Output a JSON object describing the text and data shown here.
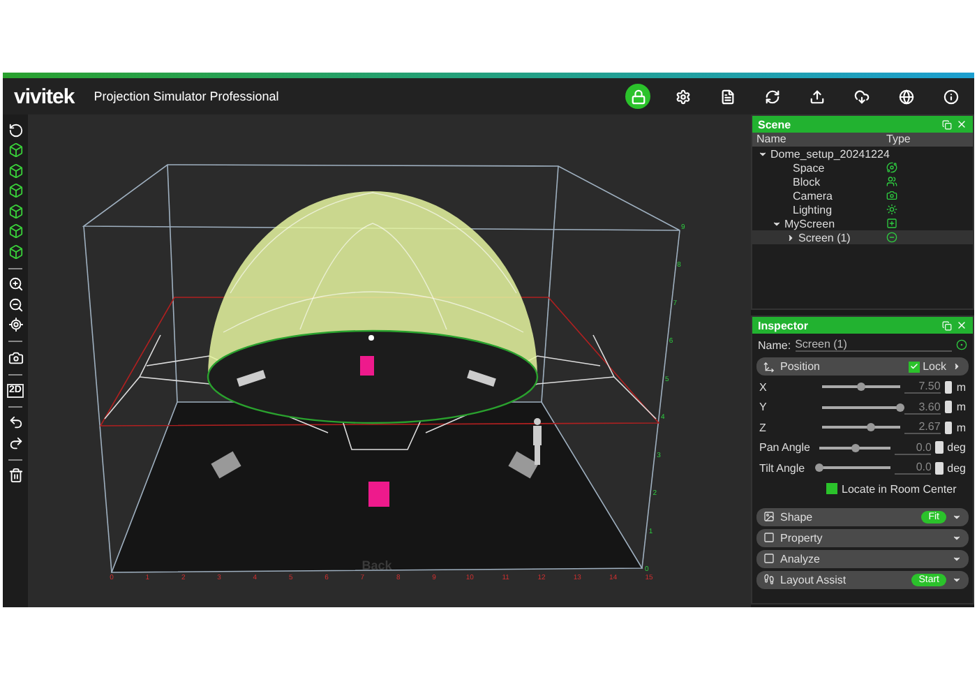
{
  "app": {
    "logo": "vivitek",
    "title": "Projection Simulator Professional"
  },
  "toolbar": [
    {
      "kind": "lock",
      "on": true
    },
    {
      "kind": "settings",
      "on": false
    },
    {
      "kind": "file",
      "on": false
    },
    {
      "kind": "refresh",
      "on": false
    },
    {
      "kind": "upload",
      "on": false
    },
    {
      "kind": "download",
      "on": false
    },
    {
      "kind": "globe",
      "on": false
    },
    {
      "kind": "info",
      "on": false
    }
  ],
  "left_tools": [
    {
      "kind": "rotate"
    },
    {
      "kind": "cube"
    },
    {
      "kind": "cube"
    },
    {
      "kind": "cube"
    },
    {
      "kind": "cube"
    },
    {
      "kind": "cube"
    },
    {
      "kind": "cube"
    },
    {
      "kind": "separator"
    },
    {
      "kind": "zoom_in"
    },
    {
      "kind": "zoom_out"
    },
    {
      "kind": "locate"
    },
    {
      "kind": "separator"
    },
    {
      "kind": "camera"
    },
    {
      "kind": "separator"
    },
    {
      "kind": "text",
      "label": "2D"
    },
    {
      "kind": "separator"
    },
    {
      "kind": "undo"
    },
    {
      "kind": "redo"
    },
    {
      "kind": "separator"
    },
    {
      "kind": "trash"
    }
  ],
  "viewport": {
    "floor_label": "Back",
    "x_ticks": [
      "0",
      "1",
      "2",
      "3",
      "4",
      "5",
      "6",
      "7",
      "8",
      "9",
      "10",
      "11",
      "12",
      "13",
      "14",
      "15"
    ],
    "z_ticks": [
      "0",
      "1",
      "2",
      "3",
      "4",
      "5",
      "6",
      "7",
      "8",
      "9"
    ]
  },
  "scene": {
    "title": "Scene",
    "columns": [
      "Name",
      "Type"
    ],
    "tree": [
      {
        "name": "Dome_setup_20241224",
        "expanded": true,
        "selected": false,
        "children": [
          {
            "name": "Space",
            "kind": "space",
            "selected": false
          },
          {
            "name": "Block",
            "kind": "block",
            "selected": false
          },
          {
            "name": "Camera",
            "kind": "camera",
            "selected": false
          },
          {
            "name": "Lighting",
            "kind": "lighting",
            "selected": false
          },
          {
            "name": "MyScreen",
            "kind": "group",
            "expanded": true,
            "selected": false,
            "children": [
              {
                "name": "Screen (1)",
                "kind": "screen",
                "expanded": false,
                "selected": true
              }
            ]
          }
        ]
      }
    ]
  },
  "inspector": {
    "title": "Inspector",
    "name_label": "Name:",
    "name_value": "Screen (1)",
    "position": {
      "title": "Position",
      "lock_label": "Lock",
      "lock_checked": true
    },
    "fields": [
      {
        "label": "X",
        "level": 0.5,
        "value": "7.50",
        "unit": "m"
      },
      {
        "label": "Y",
        "level": 1.0,
        "value": "3.60",
        "unit": "m"
      },
      {
        "label": "Z",
        "level": 0.62,
        "value": "2.67",
        "unit": "m"
      },
      {
        "label": "Pan Angle",
        "level": 0.5,
        "value": "0.0",
        "unit": "deg"
      },
      {
        "label": "Tilt Angle",
        "level": 0.0,
        "value": "0.0",
        "unit": "deg"
      }
    ],
    "locate": {
      "label": "Locate in Room Center",
      "checked": true
    },
    "sections": [
      {
        "kind": "shape",
        "title": "Shape",
        "action": "Fit"
      },
      {
        "kind": "property",
        "title": "Property"
      },
      {
        "kind": "analyze",
        "title": "Analyze"
      },
      {
        "kind": "layout",
        "title": "Layout Assist",
        "action": "Start"
      }
    ]
  }
}
